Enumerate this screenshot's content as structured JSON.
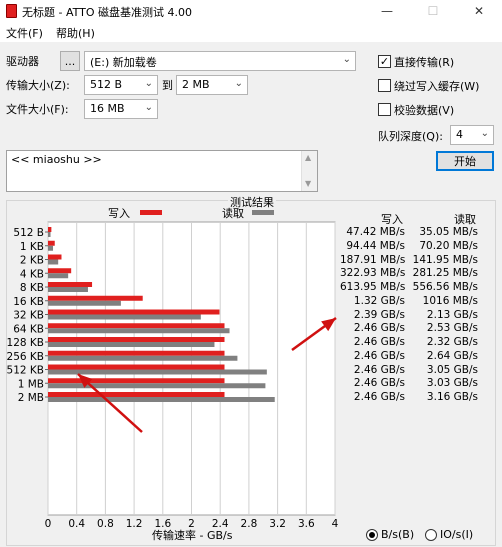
{
  "window": {
    "title": "无标题 - ATTO 磁盘基准测试 4.00",
    "minimize": "—",
    "maximize": "☐",
    "close": "✕"
  },
  "menu": {
    "file": "文件(F)",
    "help": "帮助(H)"
  },
  "settings": {
    "drive_label": "驱动器",
    "browse_label": "...",
    "drive_value": "(E:) 新加载卷",
    "transfer_label": "传输大小(Z):",
    "transfer_from": "512 B",
    "to_label": "到",
    "transfer_to": "2 MB",
    "filesize_label": "文件大小(F):",
    "filesize_value": "16 MB",
    "direct_io": {
      "label": "直接传输(R)",
      "checked": true,
      "mark": "✓"
    },
    "bypass_write_cache": {
      "label": "绕过写入缓存(W)",
      "checked": false
    },
    "verify_data": {
      "label": "校验数据(V)",
      "checked": false
    },
    "queue_depth_label": "队列深度(Q):",
    "queue_depth_value": "4",
    "start_button": "开始",
    "description": "<< miaoshu >>"
  },
  "results": {
    "section_title": "测试结果",
    "write_col": "写入",
    "read_col": "读取",
    "rows": [
      {
        "size": "512 B",
        "write": "47.42 MB/s",
        "read": "35.05 MB/s"
      },
      {
        "size": "1 KB",
        "write": "94.44 MB/s",
        "read": "70.20 MB/s"
      },
      {
        "size": "2 KB",
        "write": "187.91 MB/s",
        "read": "141.95 MB/s"
      },
      {
        "size": "4 KB",
        "write": "322.93 MB/s",
        "read": "281.25 MB/s"
      },
      {
        "size": "8 KB",
        "write": "613.95 MB/s",
        "read": "556.56 MB/s"
      },
      {
        "size": "16 KB",
        "write": "1.32 GB/s",
        "read": "1016 MB/s"
      },
      {
        "size": "32 KB",
        "write": "2.39 GB/s",
        "read": "2.13 GB/s"
      },
      {
        "size": "64 KB",
        "write": "2.46 GB/s",
        "read": "2.53 GB/s"
      },
      {
        "size": "128 KB",
        "write": "2.46 GB/s",
        "read": "2.32 GB/s"
      },
      {
        "size": "256 KB",
        "write": "2.46 GB/s",
        "read": "2.64 GB/s"
      },
      {
        "size": "512 KB",
        "write": "2.46 GB/s",
        "read": "3.05 GB/s"
      },
      {
        "size": "1 MB",
        "write": "2.46 GB/s",
        "read": "3.03 GB/s"
      },
      {
        "size": "2 MB",
        "write": "2.46 GB/s",
        "read": "3.16 GB/s"
      }
    ],
    "units": {
      "bytes": "B/s(B)",
      "io": "IO/s(I)",
      "selected": "bytes"
    }
  },
  "chart_data": {
    "type": "bar",
    "orientation": "horizontal",
    "categories": [
      "512 B",
      "1 KB",
      "2 KB",
      "4 KB",
      "8 KB",
      "16 KB",
      "32 KB",
      "64 KB",
      "128 KB",
      "256 KB",
      "512 KB",
      "1 MB",
      "2 MB"
    ],
    "series": [
      {
        "name": "写入",
        "color": "#e0201f",
        "values": [
          0.047,
          0.094,
          0.188,
          0.323,
          0.614,
          1.32,
          2.39,
          2.46,
          2.46,
          2.46,
          2.46,
          2.46,
          2.46
        ]
      },
      {
        "name": "读取",
        "color": "#808080",
        "values": [
          0.035,
          0.07,
          0.142,
          0.281,
          0.557,
          1.016,
          2.13,
          2.53,
          2.32,
          2.64,
          3.05,
          3.03,
          3.16
        ]
      }
    ],
    "xlim": [
      0,
      4
    ],
    "xticks": [
      "0",
      "0.4",
      "0.8",
      "1.2",
      "1.6",
      "2",
      "2.4",
      "2.8",
      "3.2",
      "3.6",
      "4"
    ],
    "xlabel": "传输速率 - GB/s",
    "grid": true,
    "legend_placement": "top"
  },
  "annotations": {
    "arrow_color": "#d01010",
    "count": 2
  }
}
